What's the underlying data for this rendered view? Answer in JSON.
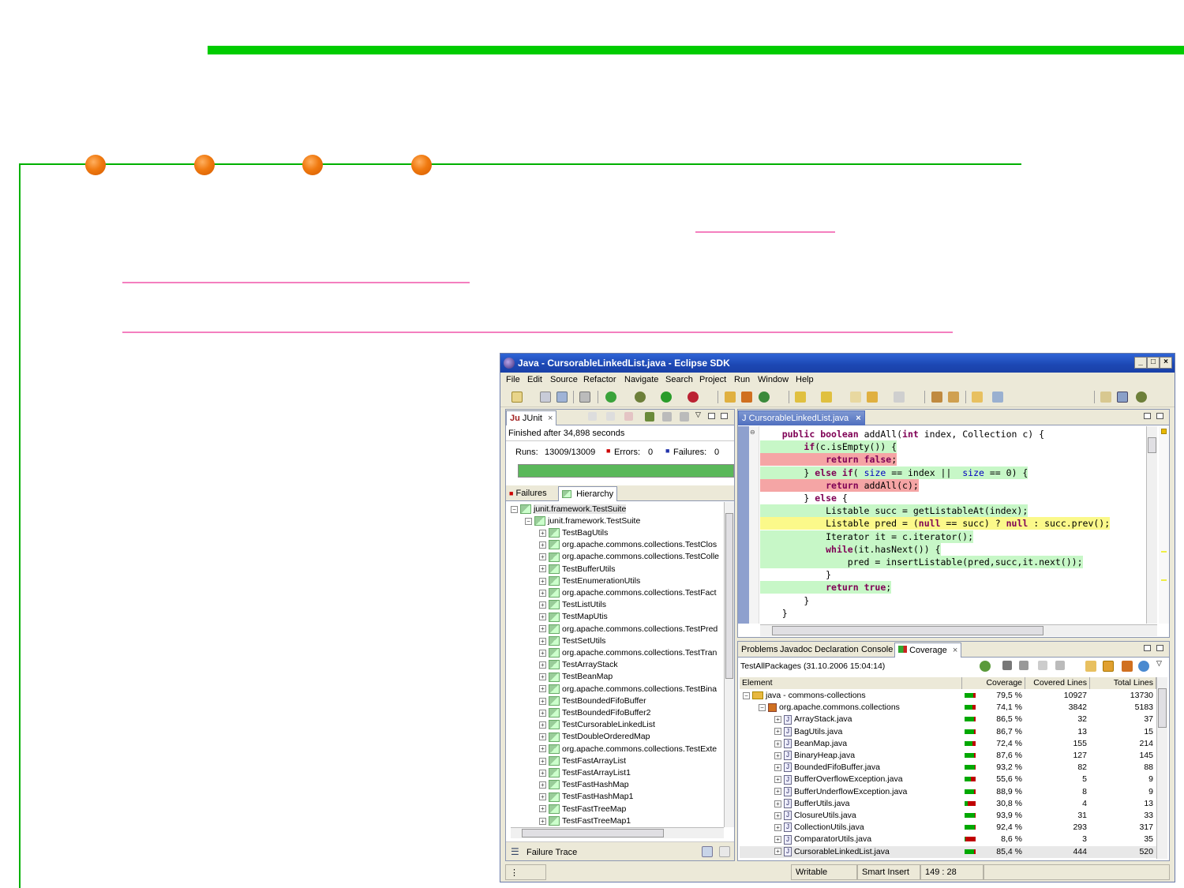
{
  "window": {
    "title": "Java - CursorableLinkedList.java - Eclipse SDK",
    "controls": {
      "minimize": "_",
      "maximize": "□",
      "close": "×"
    }
  },
  "menu": [
    "File",
    "Edit",
    "Source",
    "Refactor",
    "Navigate",
    "Search",
    "Project",
    "Run",
    "Window",
    "Help"
  ],
  "junit": {
    "tab_label": "JUnit",
    "finished": "Finished after 34,898 seconds",
    "runs_label": "Runs:",
    "runs_value": "13009/13009",
    "errors_label": "Errors:",
    "errors_value": "0",
    "failures_label": "Failures:",
    "failures_value": "0",
    "progress": 1.0,
    "tabs": {
      "failures": "Failures",
      "hierarchy": "Hierarchy"
    },
    "tree_root": "junit.framework.TestSuite",
    "tree_child": "junit.framework.TestSuite",
    "tests": [
      "TestBagUtils",
      "org.apache.commons.collections.TestClos",
      "org.apache.commons.collections.TestColle",
      "TestBufferUtils",
      "TestEnumerationUtils",
      "org.apache.commons.collections.TestFact",
      "TestListUtils",
      "TestMapUtis",
      "org.apache.commons.collections.TestPred",
      "TestSetUtils",
      "org.apache.commons.collections.TestTran",
      "TestArrayStack",
      "TestBeanMap",
      "org.apache.commons.collections.TestBina",
      "TestBoundedFifoBuffer",
      "TestBoundedFifoBuffer2",
      "TestCursorableLinkedList",
      "TestDoubleOrderedMap",
      "org.apache.commons.collections.TestExte",
      "TestFastArrayList",
      "TestFastArrayList1",
      "TestFastHashMap",
      "TestFastHashMap1",
      "TestFastTreeMap",
      "TestFastTreeMap1"
    ],
    "failure_trace": "Failure Trace"
  },
  "editor": {
    "tab_label": "CursorableLinkedList.java",
    "lines": [
      {
        "hl": "none",
        "text": "    public boolean addAll(int index, Collection c) {"
      },
      {
        "hl": "green",
        "text": "        if(c.isEmpty()) {"
      },
      {
        "hl": "red",
        "text": "            return false;"
      },
      {
        "hl": "green",
        "text": "        } else if( size == index ||  size == 0) {"
      },
      {
        "hl": "red",
        "text": "            return addAll(c);"
      },
      {
        "hl": "none",
        "text": "        } else {"
      },
      {
        "hl": "green",
        "text": "            Listable succ = getListableAt(index);"
      },
      {
        "hl": "yellow",
        "text": "            Listable pred = (null == succ) ? null : succ.prev();"
      },
      {
        "hl": "green",
        "text": "            Iterator it = c.iterator();"
      },
      {
        "hl": "green",
        "text": "            while(it.hasNext()) {"
      },
      {
        "hl": "green",
        "text": "                pred = insertListable(pred,succ,it.next());"
      },
      {
        "hl": "none",
        "text": "            }"
      },
      {
        "hl": "green",
        "text": "            return true;"
      },
      {
        "hl": "none",
        "text": "        }"
      },
      {
        "hl": "none",
        "text": "    }"
      }
    ]
  },
  "bottom_tabs": [
    "Problems",
    "Javadoc",
    "Declaration",
    "Console",
    "Coverage"
  ],
  "coverage": {
    "session": "TestAllPackages (31.10.2006 15:04:14)",
    "columns": [
      "Element",
      "Coverage",
      "Covered Lines",
      "Total Lines"
    ],
    "rows": [
      {
        "level": 0,
        "kind": "project",
        "name": "java - commons-collections",
        "coverage": "79,5 %",
        "pct": 0.795,
        "covered": "10927",
        "total": "13730"
      },
      {
        "level": 1,
        "kind": "package",
        "name": "org.apache.commons.collections",
        "coverage": "74,1 %",
        "pct": 0.741,
        "covered": "3842",
        "total": "5183"
      },
      {
        "level": 2,
        "kind": "file",
        "name": "ArrayStack.java",
        "coverage": "86,5 %",
        "pct": 0.865,
        "covered": "32",
        "total": "37"
      },
      {
        "level": 2,
        "kind": "file",
        "name": "BagUtils.java",
        "coverage": "86,7 %",
        "pct": 0.867,
        "covered": "13",
        "total": "15"
      },
      {
        "level": 2,
        "kind": "file",
        "name": "BeanMap.java",
        "coverage": "72,4 %",
        "pct": 0.724,
        "covered": "155",
        "total": "214"
      },
      {
        "level": 2,
        "kind": "file",
        "name": "BinaryHeap.java",
        "coverage": "87,6 %",
        "pct": 0.876,
        "covered": "127",
        "total": "145"
      },
      {
        "level": 2,
        "kind": "file",
        "name": "BoundedFifoBuffer.java",
        "coverage": "93,2 %",
        "pct": 0.932,
        "covered": "82",
        "total": "88"
      },
      {
        "level": 2,
        "kind": "file",
        "name": "BufferOverflowException.java",
        "coverage": "55,6 %",
        "pct": 0.556,
        "covered": "5",
        "total": "9"
      },
      {
        "level": 2,
        "kind": "file",
        "name": "BufferUnderflowException.java",
        "coverage": "88,9 %",
        "pct": 0.889,
        "covered": "8",
        "total": "9"
      },
      {
        "level": 2,
        "kind": "file",
        "name": "BufferUtils.java",
        "coverage": "30,8 %",
        "pct": 0.308,
        "covered": "4",
        "total": "13"
      },
      {
        "level": 2,
        "kind": "file",
        "name": "ClosureUtils.java",
        "coverage": "93,9 %",
        "pct": 0.939,
        "covered": "31",
        "total": "33"
      },
      {
        "level": 2,
        "kind": "file",
        "name": "CollectionUtils.java",
        "coverage": "92,4 %",
        "pct": 0.924,
        "covered": "293",
        "total": "317"
      },
      {
        "level": 2,
        "kind": "file",
        "name": "ComparatorUtils.java",
        "coverage": "8,6 %",
        "pct": 0.086,
        "covered": "3",
        "total": "35"
      },
      {
        "level": 2,
        "kind": "file",
        "name": "CursorableLinkedList.java",
        "coverage": "85,4 %",
        "pct": 0.854,
        "covered": "444",
        "total": "520"
      }
    ]
  },
  "status": {
    "writable": "Writable",
    "insert_mode": "Smart Insert",
    "position": "149 : 28"
  },
  "colors": {
    "accent_green": "#00cc00",
    "dot_orange": "#f07a10",
    "pink_line": "#f47fbf",
    "progress_green": "#5ab85a"
  }
}
